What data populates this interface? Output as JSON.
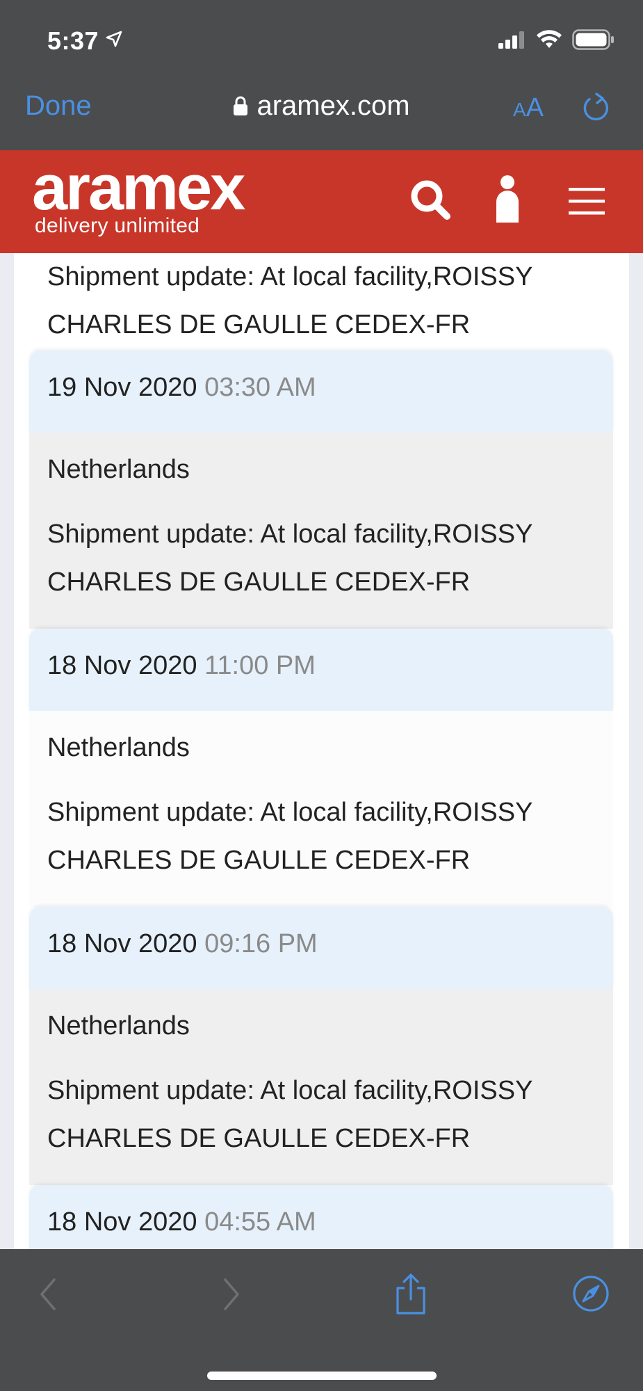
{
  "status_bar": {
    "time": "5:37"
  },
  "safari": {
    "done_label": "Done",
    "domain": "aramex.com",
    "text_size_label_small": "A",
    "text_size_label_large": "A"
  },
  "brand": {
    "logo_text": "aramex",
    "tagline": "delivery unlimited",
    "color": "#c8362a"
  },
  "tracking": {
    "top_partial_update": "Shipment update: At local facility,ROISSY CHARLES DE GAULLE CEDEX-FR",
    "entries": [
      {
        "date": "19 Nov 2020",
        "time": "03:30 AM",
        "location": "Netherlands",
        "update": "Shipment update: At local facility,ROISSY CHARLES DE GAULLE CEDEX-FR"
      },
      {
        "date": "18 Nov 2020",
        "time": "11:00 PM",
        "location": "Netherlands",
        "update": "Shipment update: At local facility,ROISSY CHARLES DE GAULLE CEDEX-FR"
      },
      {
        "date": "18 Nov 2020",
        "time": "09:16 PM",
        "location": "Netherlands",
        "update": "Shipment update: At local facility,ROISSY CHARLES DE GAULLE CEDEX-FR"
      },
      {
        "date": "18 Nov 2020",
        "time": "04:55 AM"
      }
    ]
  },
  "icons": {
    "header": [
      "search-icon",
      "user-icon",
      "menu-icon"
    ],
    "toolbar": [
      "back-icon",
      "forward-icon",
      "share-icon",
      "compass-icon"
    ]
  }
}
